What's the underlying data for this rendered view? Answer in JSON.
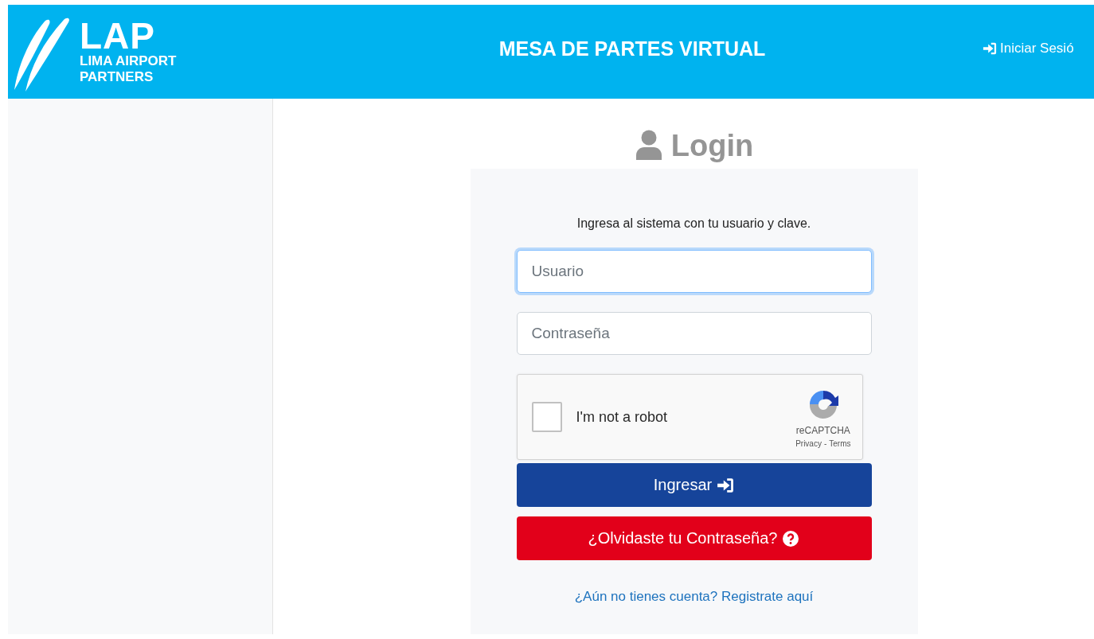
{
  "header": {
    "logo": {
      "mark": "LAP",
      "line_1": "LIMA AIRPORT",
      "line_2": "PARTNERS"
    },
    "title": "MESA DE PARTES VIRTUAL",
    "login_link": "Iniciar Sesió"
  },
  "login": {
    "heading": "Login",
    "intro": "Ingresa al sistema con tu usuario y clave.",
    "fields": [
      {
        "placeholder": "Usuario",
        "focused": true
      },
      {
        "placeholder": "Contraseña",
        "focused": false
      }
    ],
    "captcha": {
      "label": "I'm not a robot",
      "checked": false,
      "brand": "reCAPTCHA",
      "privacy": "Privacy",
      "separator": "-",
      "terms": "Terms"
    },
    "buttons": [
      {
        "label": "Ingresar",
        "kind": "primary"
      },
      {
        "label": "¿Olvidaste tu Contraseña?",
        "kind": "danger"
      }
    ],
    "register_link": "¿Aún no tienes cuenta? Registrate aquí"
  }
}
